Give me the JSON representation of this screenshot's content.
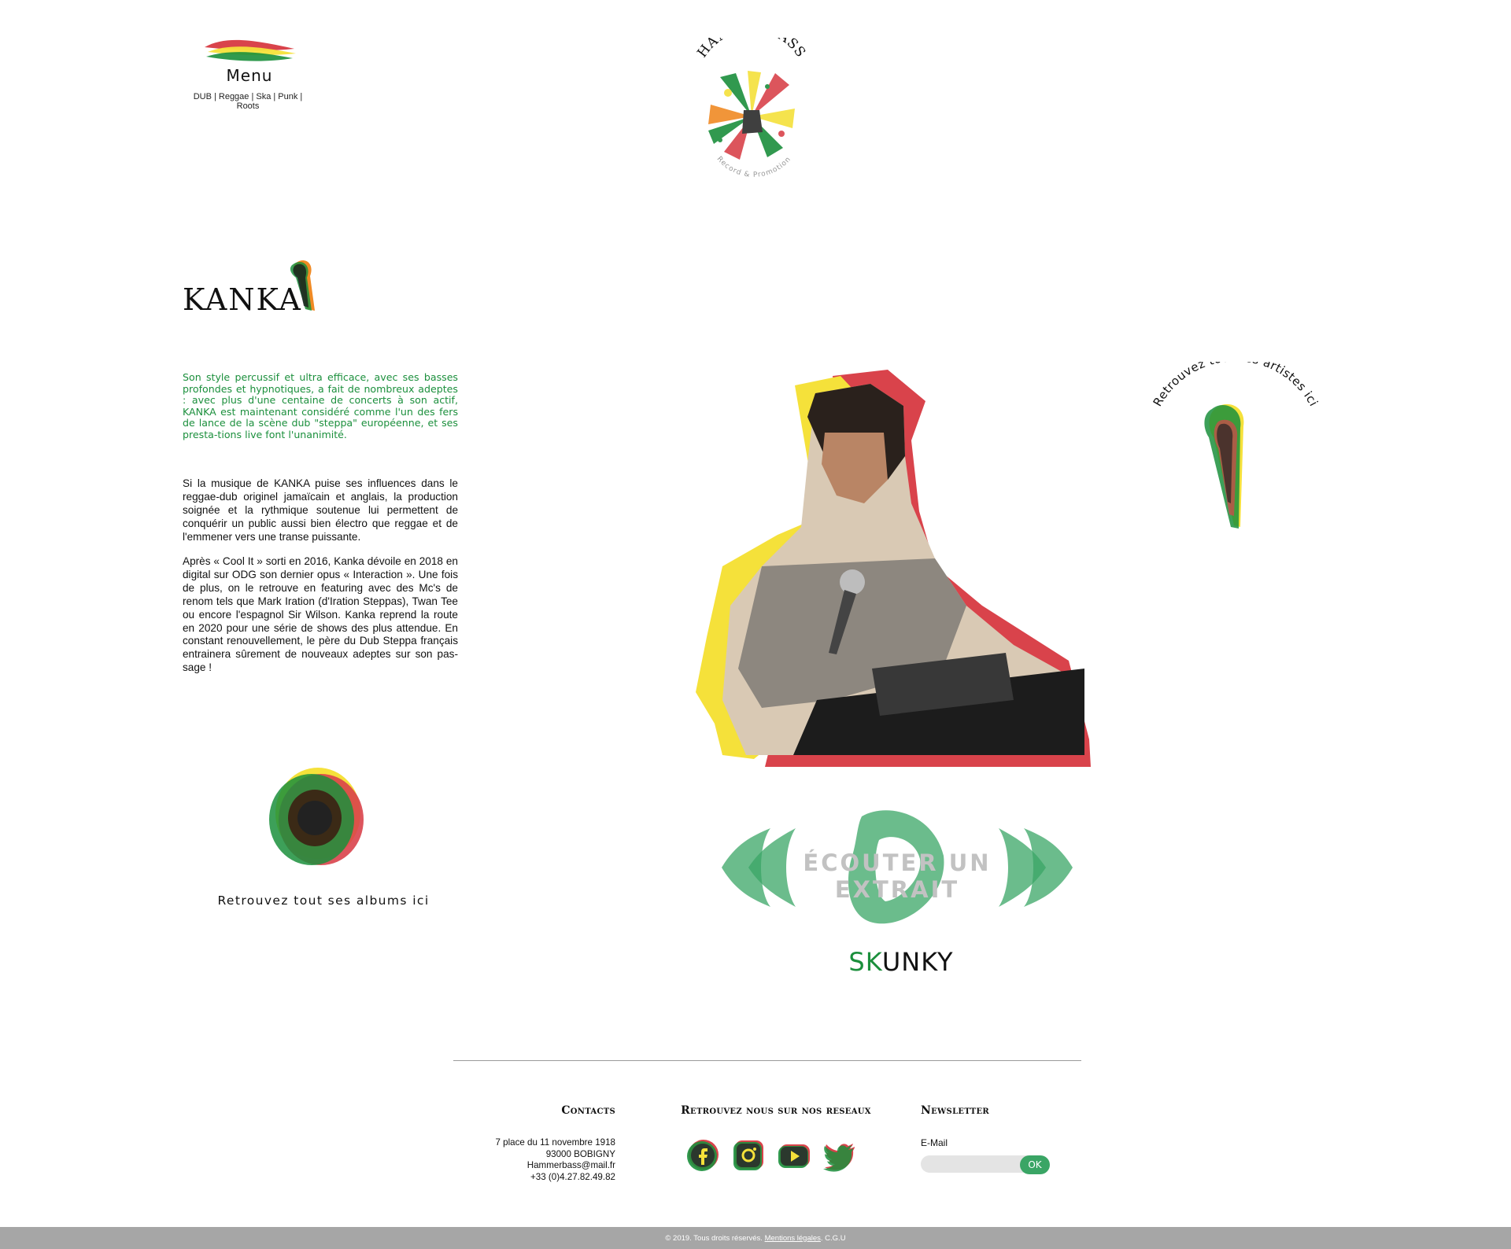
{
  "header": {
    "menu_label": "Menu",
    "genres": "DUB | Reggae | Ska | Punk | Roots",
    "brand_name": "HAMMERBASS",
    "brand_tagline": "Record & Promotion"
  },
  "artist": {
    "name": "KANKA",
    "intro": "Son style percussif et ultra efficace, avec ses basses profondes et hypnotiques, a fait de nombreux adeptes : avec plus d'une centaine de concerts à son actif, KANKA est maintenant considéré comme l'un des fers de lance de la scène dub \"steppa\" européenne, et ses presta-tions live font l'unanimité.",
    "bio_paragraph_1": "Si la musique de KANKA puise ses influences dans le reggae-dub originel jamaïcain et anglais, la production soignée et la rythmique soutenue lui permettent de conquérir un public aussi bien électro que reggae et de l'emmener vers une transe puissante.",
    "bio_paragraph_2": "Après « Cool It » sorti en 2016, Kanka dévoile en 2018 en digital sur ODG son dernier opus « Interaction ». Une fois de plus, on le retrouve en featuring avec des Mc's de renom tels que Mark Iration (d'Iration Steppas), Twan Tee ou encore l'espagnol Sir Wilson. Kanka reprend la route en 2020 pour une série de shows des plus attendue. En constant renouvellement, le père du Dub Steppa français entrainera sûrement de nouveaux adeptes sur son pas-sage !"
  },
  "links": {
    "all_artists": "Retrouvez tous les artistes ici",
    "albums": "Retrouvez tout ses albums ici"
  },
  "player": {
    "label_line1": "ÉCOUTER UN",
    "label_line2": "EXTRAIT",
    "track_prefix": "SK",
    "track_suffix": "UNKY"
  },
  "footer": {
    "contacts": {
      "title": "Contacts",
      "address_line1": "7 place du 11 novembre 1918",
      "address_line2": "93000 BOBIGNY",
      "email": "Hammerbass@mail.fr",
      "phone": "+33 (0)4.27.82.49.82"
    },
    "social": {
      "title": "Retrouvez nous sur nos reseaux",
      "icons": [
        "facebook-icon",
        "instagram-icon",
        "youtube-icon",
        "twitter-icon"
      ]
    },
    "newsletter": {
      "title": "Newsletter",
      "email_label": "E-Mail",
      "email_value": "",
      "email_placeholder": "",
      "submit_label": "OK"
    }
  },
  "bottom_bar": {
    "copyright": "© 2019. Tous droits réservés.",
    "legal_link": "Mentions légales",
    "separator": ".",
    "cgu_link": "C.G.U"
  },
  "colors": {
    "green": "#1b8f3c",
    "light_green": "#3aa565",
    "yellow": "#f5e13a",
    "red": "#d9434b",
    "orange": "#f08a24",
    "grey_bar": "#a6a6a6"
  }
}
